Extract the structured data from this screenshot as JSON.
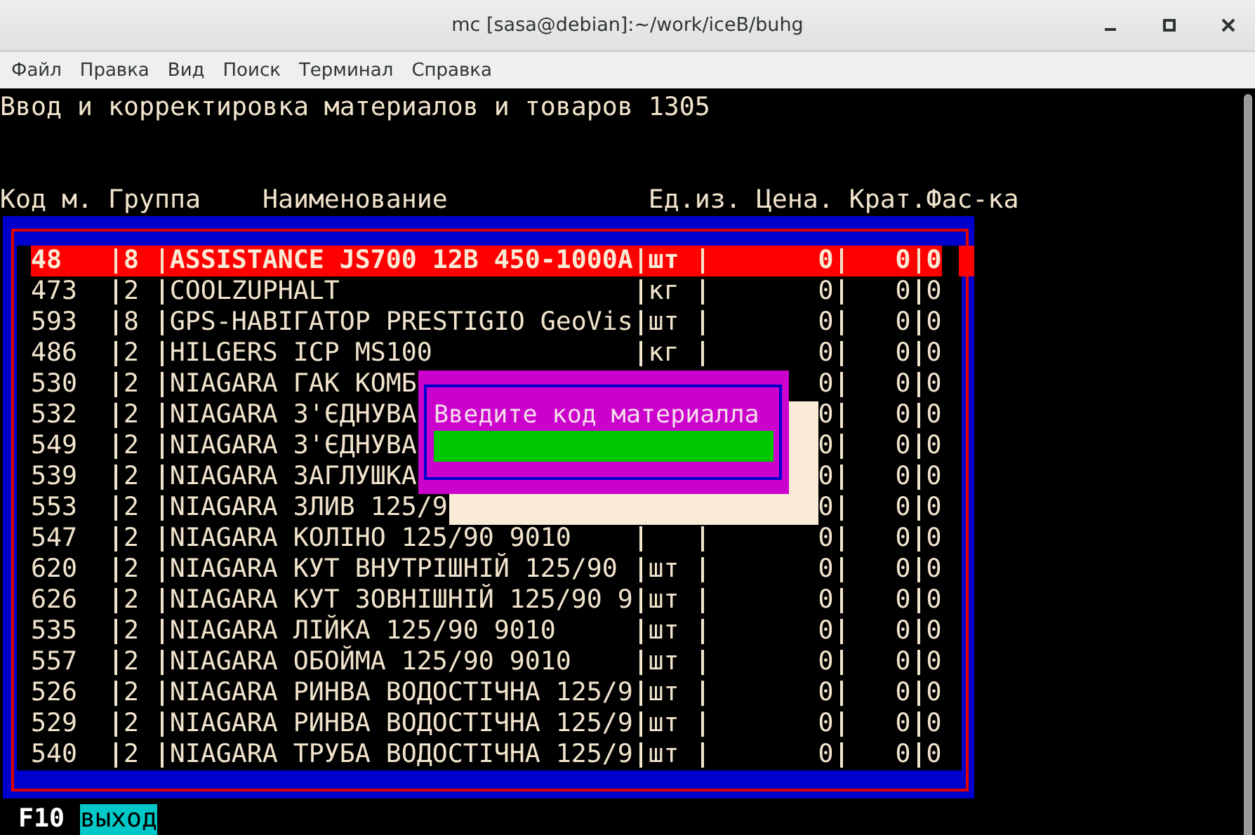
{
  "window": {
    "title": "mc [sasa@debian]:~/work/iceB/buhg"
  },
  "menu": [
    "Файл",
    "Правка",
    "Вид",
    "Поиск",
    "Терминал",
    "Справка"
  ],
  "terminal": {
    "heading": "Ввод и корректировка материалов и товаров 1305",
    "header": "Код м. Группа    Наименование             Ед.из. Цена. Крат.Фас-ка",
    "rows": [
      {
        "code": "48",
        "group": "8",
        "name": "ASSISTANCE JS700 12B 450-1000A",
        "unit": "шт",
        "price": "0",
        "krat": "0",
        "fas": "0",
        "selected": true
      },
      {
        "code": "473",
        "group": "2",
        "name": "COOLZUPHALT",
        "unit": "кг",
        "price": "0",
        "krat": "0",
        "fas": "0",
        "selected": false
      },
      {
        "code": "593",
        "group": "8",
        "name": "GPS-НАВІГАТОР PRESTIGIO GeoVis",
        "unit": "шт",
        "price": "0",
        "krat": "0",
        "fas": "0",
        "selected": false
      },
      {
        "code": "486",
        "group": "2",
        "name": "HILGERS ICP MS100",
        "unit": "кг",
        "price": "0",
        "krat": "0",
        "fas": "0",
        "selected": false
      },
      {
        "code": "530",
        "group": "2",
        "name": "NIAGARA ГАК КОМБ",
        "price": "0",
        "krat": "0",
        "fas": "0",
        "selected": false
      },
      {
        "code": "532",
        "group": "2",
        "name": "NIAGARA З'ЄДНУВА",
        "price": "0",
        "krat": "0",
        "fas": "0",
        "selected": false
      },
      {
        "code": "549",
        "group": "2",
        "name": "NIAGARA З'ЄДНУВА",
        "price": "0",
        "krat": "0",
        "fas": "0",
        "selected": false
      },
      {
        "code": "539",
        "group": "2",
        "name": "NIAGARA ЗАГЛУШКА",
        "price": "0",
        "krat": "0",
        "fas": "0",
        "selected": false
      },
      {
        "code": "553",
        "group": "2",
        "name": "NIAGARA ЗЛИВ 125/9",
        "price": "0",
        "krat": "0",
        "fas": "0",
        "selected": false
      },
      {
        "code": "547",
        "group": "2",
        "name": "NIAGARA КОЛІНО 125/90 9010",
        "price": "0",
        "krat": "0",
        "fas": "0",
        "selected": false
      },
      {
        "code": "620",
        "group": "2",
        "name": "NIAGARA КУТ ВНУТРІШНІЙ 125/90",
        "unit": "шт",
        "price": "0",
        "krat": "0",
        "fas": "0",
        "selected": false
      },
      {
        "code": "626",
        "group": "2",
        "name": "NIAGARA КУТ ЗОВНІШНІЙ 125/90 9",
        "unit": "шт",
        "price": "0",
        "krat": "0",
        "fas": "0",
        "selected": false
      },
      {
        "code": "535",
        "group": "2",
        "name": "NIAGARA ЛІЙКА 125/90 9010",
        "unit": "шт",
        "price": "0",
        "krat": "0",
        "fas": "0",
        "selected": false
      },
      {
        "code": "557",
        "group": "2",
        "name": "NIAGARA ОБОЙМА 125/90 9010",
        "unit": "шт",
        "price": "0",
        "krat": "0",
        "fas": "0",
        "selected": false
      },
      {
        "code": "526",
        "group": "2",
        "name": "NIAGARA РИНВА ВОДОСТІЧНА 125/9",
        "unit": "шт",
        "price": "0",
        "krat": "0",
        "fas": "0",
        "selected": false
      },
      {
        "code": "529",
        "group": "2",
        "name": "NIAGARA РИНВА ВОДОСТІЧНА 125/9",
        "unit": "шт",
        "price": "0",
        "krat": "0",
        "fas": "0",
        "selected": false
      },
      {
        "code": "540",
        "group": "2",
        "name": "NIAGARA ТРУБА ВОДОСТІЧНА 125/9",
        "unit": "шт",
        "price": "0",
        "krat": "0",
        "fas": "0",
        "selected": false
      }
    ],
    "dialog": {
      "prompt": "Введите код материалла"
    },
    "footer": {
      "key": "F10",
      "label": "выход"
    }
  }
}
